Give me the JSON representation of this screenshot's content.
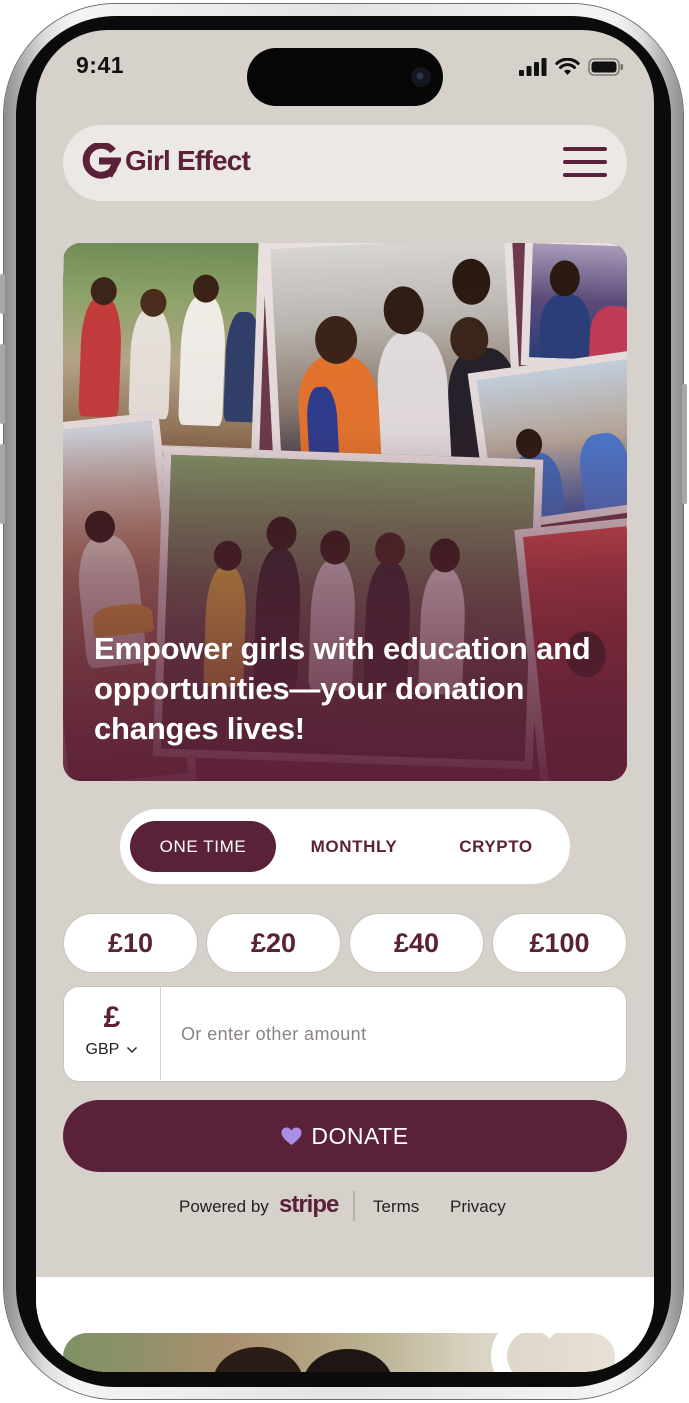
{
  "status_bar": {
    "time": "9:41"
  },
  "header": {
    "logo_text": "Girl Effect",
    "logo_icon": "girl-effect-g-icon",
    "menu_icon": "hamburger-menu-icon"
  },
  "hero": {
    "title": "Empower girls with education and opportunities—your donation changes lives!"
  },
  "frequency_tabs": [
    {
      "label": "ONE TIME",
      "active": true
    },
    {
      "label": "MONTHLY",
      "active": false
    },
    {
      "label": "CRYPTO",
      "active": false
    }
  ],
  "amount_options": [
    "£10",
    "£20",
    "£40",
    "£100"
  ],
  "custom_amount": {
    "currency_symbol": "£",
    "currency_code": "GBP",
    "placeholder": "Or enter other amount"
  },
  "donate_button": {
    "label": "DONATE",
    "icon": "heart-icon"
  },
  "footer": {
    "powered_by": "Powered by",
    "brand": "stripe",
    "terms": "Terms",
    "privacy": "Privacy"
  },
  "colors": {
    "brand": "#5b2138",
    "page_background": "#d7d1cb",
    "heart": "#a98ee6"
  }
}
